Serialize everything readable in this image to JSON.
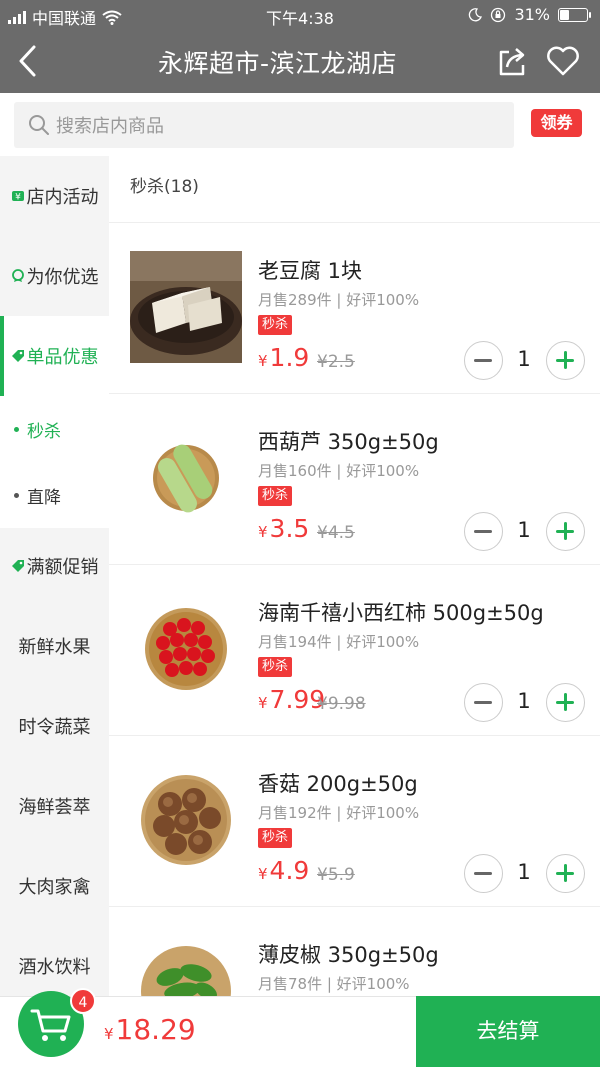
{
  "status_bar": {
    "carrier": "中国联通",
    "time": "下午4:38",
    "battery": "31%",
    "battery_level": 0.31
  },
  "header": {
    "title": "永辉超市-滨江龙湖店",
    "icons": [
      "back-icon",
      "share-icon",
      "heart-icon"
    ]
  },
  "search": {
    "placeholder": "搜索店内商品",
    "coupon_label": "领券"
  },
  "sidebar": {
    "items": [
      {
        "label": "店内活动",
        "icon": "yen-tag-icon"
      },
      {
        "label": "为你优选",
        "icon": "badge-icon"
      },
      {
        "label": "单品优惠",
        "icon": "price-tag-icon",
        "active": true
      },
      {
        "label": "满额促销",
        "icon": "price-tag-icon"
      },
      {
        "label": "新鲜水果"
      },
      {
        "label": "时令蔬菜"
      },
      {
        "label": "海鲜荟萃"
      },
      {
        "label": "大肉家禽"
      },
      {
        "label": "酒水饮料"
      }
    ],
    "sub_items": [
      {
        "label": "秒杀",
        "active": true
      },
      {
        "label": "直降"
      }
    ]
  },
  "section": {
    "title": "秒杀(18)"
  },
  "products": [
    {
      "name": "老豆腐 1块",
      "sales": "月售289件 | 好评100%",
      "badge": "秒杀",
      "currency": "¥",
      "price": "1.9",
      "orig_price": "¥2.5",
      "qty": "1",
      "image": "tofu-image"
    },
    {
      "name": "西葫芦 350g±50g",
      "sales": "月售160件 | 好评100%",
      "badge": "秒杀",
      "currency": "¥",
      "price": "3.5",
      "orig_price": "¥4.5",
      "qty": "1",
      "image": "zucchini-image"
    },
    {
      "name": "海南千禧小西红柿 500g±50g",
      "sales": "月售194件 | 好评100%",
      "badge": "秒杀",
      "currency": "¥",
      "price": "7.99",
      "orig_price": "¥9.98",
      "qty": "1",
      "image": "cherry-tomato-image"
    },
    {
      "name": "香菇 200g±50g",
      "sales": "月售192件 | 好评100%",
      "badge": "秒杀",
      "currency": "¥",
      "price": "4.9",
      "orig_price": "¥5.9",
      "qty": "1",
      "image": "shiitake-image"
    },
    {
      "name": "薄皮椒 350g±50g",
      "sales": "月售78件 | 好评100%",
      "badge": "",
      "currency": "¥",
      "price": "",
      "orig_price": "",
      "qty": "",
      "image": "green-pepper-image"
    }
  ],
  "cart": {
    "count": "4",
    "currency": "¥",
    "total": "18.29",
    "checkout_label": "去结算"
  },
  "colors": {
    "brand_green": "#20b154",
    "price_red": "#f03a3a",
    "header_gray": "#6b6b6b"
  }
}
